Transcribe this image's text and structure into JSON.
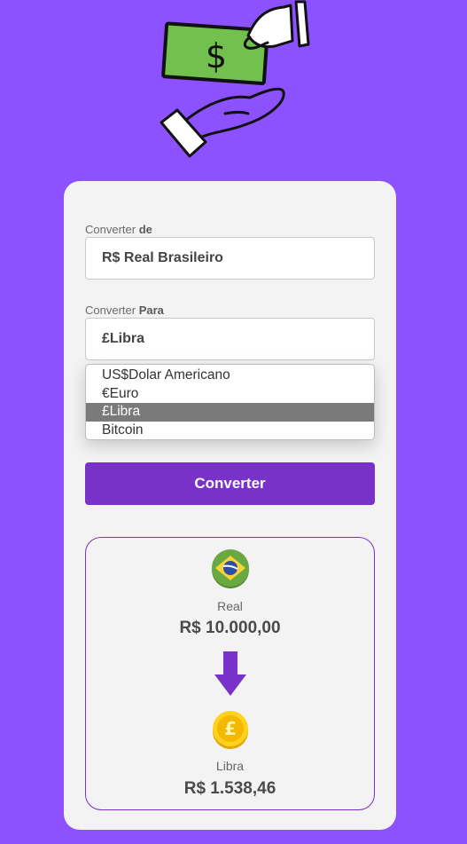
{
  "from": {
    "label_prefix": "Converter",
    "label_strong": "de",
    "value": "R$ Real Brasileiro"
  },
  "to": {
    "label_prefix": "Converter",
    "label_strong": "Para",
    "value": "£Libra",
    "options": [
      "US$Dolar Americano",
      "€Euro",
      "£Libra",
      "Bitcoin"
    ],
    "selected_index": 2
  },
  "convert_button": "Converter",
  "result": {
    "from_name": "Real",
    "from_value": "R$ 10.000,00",
    "to_name": "Libra",
    "to_value": "R$ 1.538,46"
  },
  "colors": {
    "background": "#8c52ff",
    "accent": "#7831c9",
    "money": "#72c04e"
  },
  "icons": {
    "hero": "money-exchange-icon",
    "from_currency": "brazil-flag-icon",
    "to_currency": "pound-coin-icon",
    "direction": "arrow-down-icon"
  }
}
